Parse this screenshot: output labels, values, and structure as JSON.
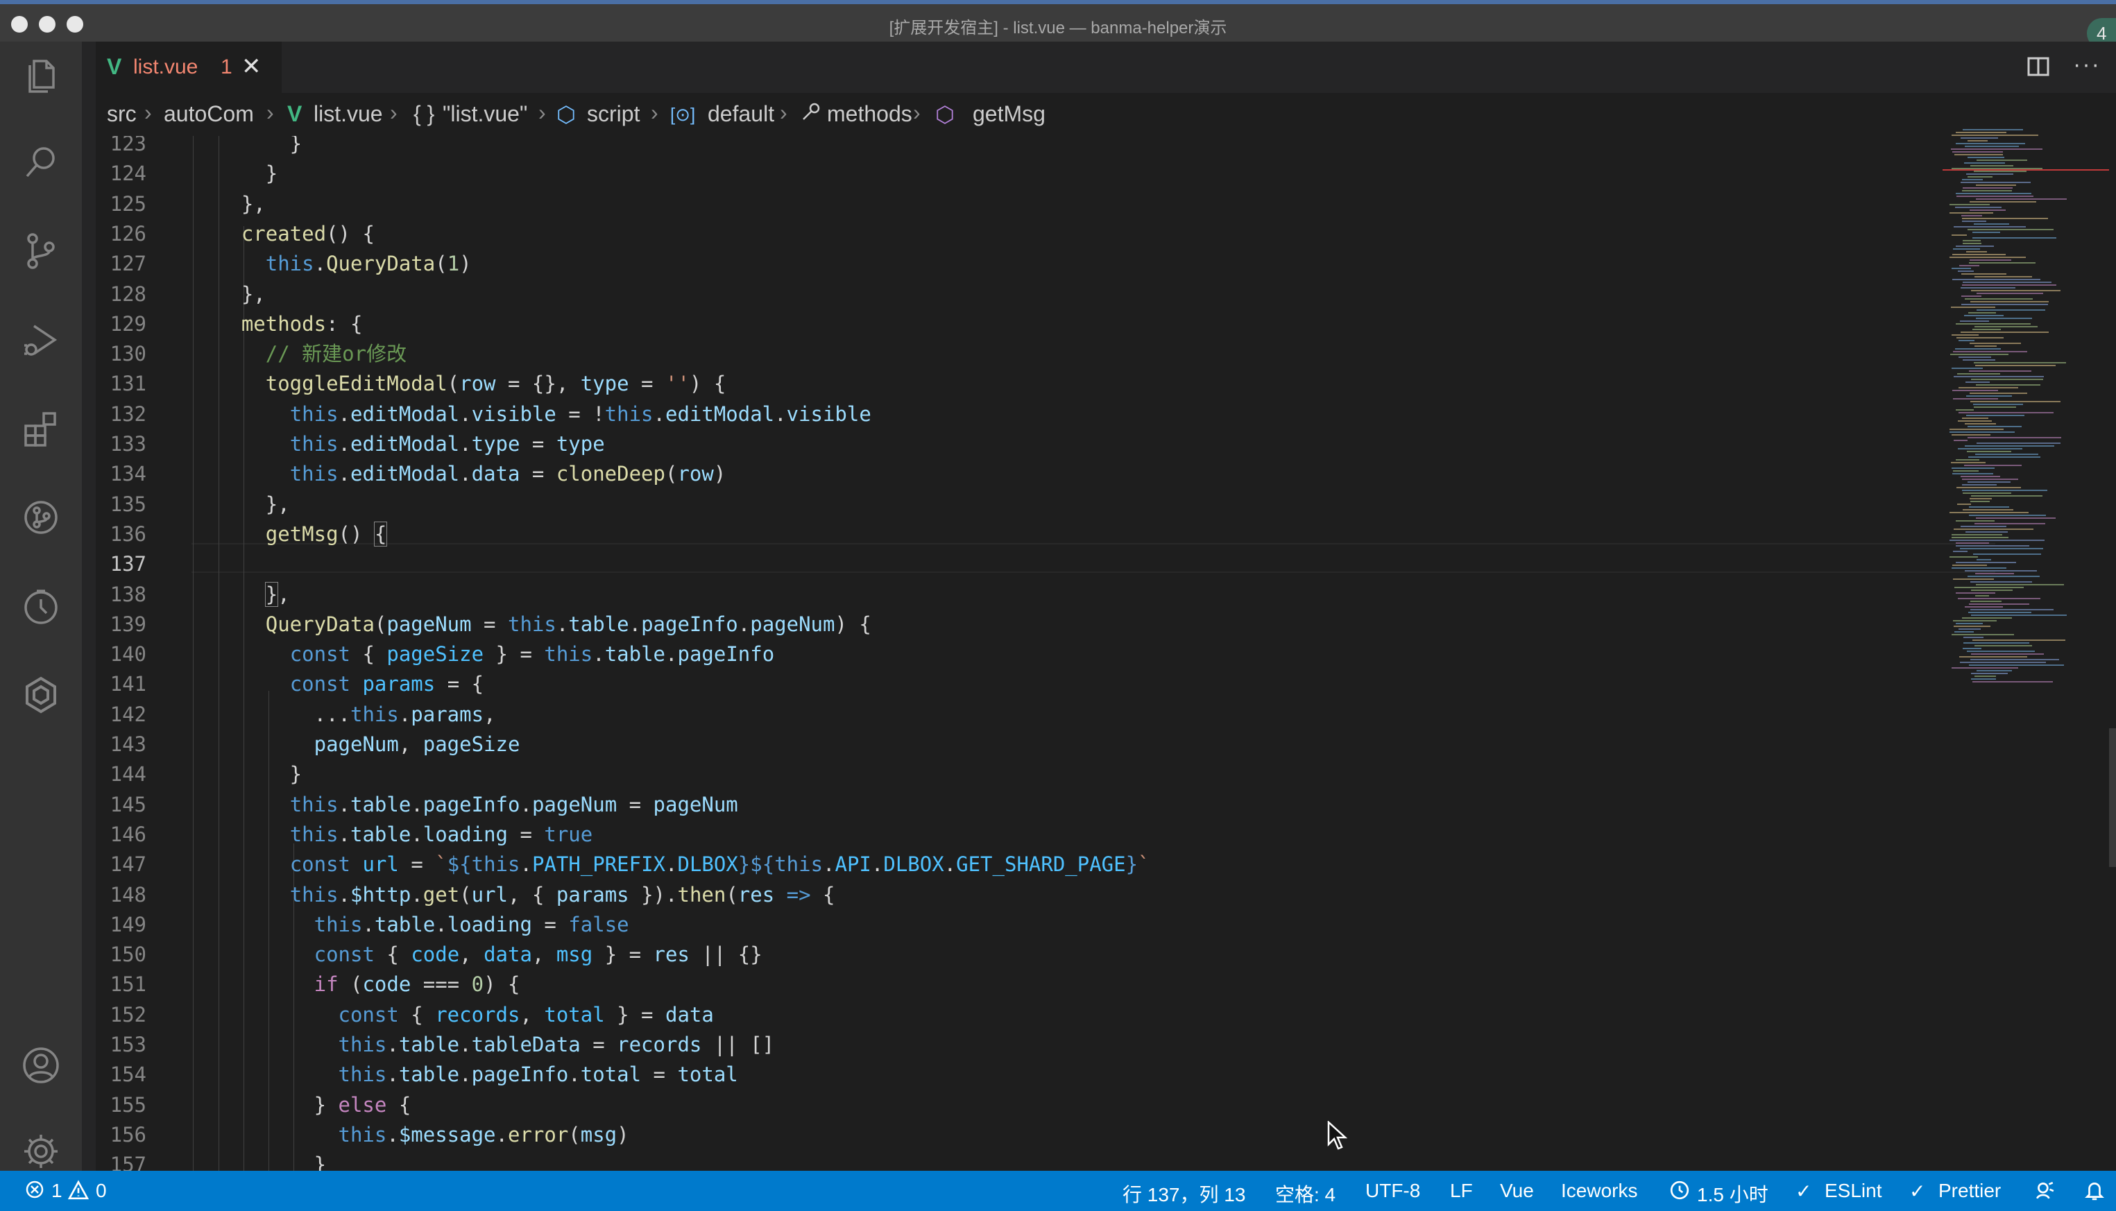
{
  "window": {
    "title": "[扩展开发宿主] - list.vue — banma-helper演示",
    "badge": "4"
  },
  "activity_bar": {
    "items": [
      "files-icon",
      "search-icon",
      "source-control-icon",
      "run-debug-icon",
      "extensions-icon",
      "git-graph-icon",
      "timeline-icon",
      "iceworks-icon"
    ],
    "bottom": [
      "account-icon",
      "settings-gear-icon"
    ]
  },
  "tab": {
    "name": "list.vue",
    "problems": "1",
    "close": "✕"
  },
  "breadcrumb": {
    "items": [
      "src",
      "autoCom",
      "list.vue",
      "\"list.vue\"",
      "script",
      "default",
      "methods",
      "getMsg"
    ],
    "obj_icon": "{ }",
    "default_icon": "[⊙]"
  },
  "editor": {
    "active_line": 137,
    "lines": [
      {
        "n": "123",
        "t": [
          "        }"
        ]
      },
      {
        "n": "124",
        "t": [
          "      }"
        ]
      },
      {
        "n": "125",
        "t": [
          "    },"
        ]
      },
      {
        "n": "126",
        "t": [
          "    ",
          "f:created",
          "() {"
        ]
      },
      {
        "n": "127",
        "t": [
          "      ",
          "k:this",
          ".",
          "f:QueryData",
          "(",
          "n:1",
          ")"
        ]
      },
      {
        "n": "128",
        "t": [
          "    },"
        ]
      },
      {
        "n": "129",
        "t": [
          "    ",
          "f:methods",
          ": {"
        ]
      },
      {
        "n": "130",
        "t": [
          "      ",
          "cm:// 新建or修改"
        ]
      },
      {
        "n": "131",
        "t": [
          "      ",
          "f:toggleEditModal",
          "(",
          "v:row",
          " = {}, ",
          "v:type",
          " = ",
          "s:''",
          ") {"
        ]
      },
      {
        "n": "132",
        "t": [
          "        ",
          "k:this",
          ".",
          "v:editModal",
          ".",
          "v:visible",
          " = !",
          "k:this",
          ".",
          "v:editModal",
          ".",
          "v:visible"
        ]
      },
      {
        "n": "133",
        "t": [
          "        ",
          "k:this",
          ".",
          "v:editModal",
          ".",
          "v:type",
          " = ",
          "v:type"
        ]
      },
      {
        "n": "134",
        "t": [
          "        ",
          "k:this",
          ".",
          "v:editModal",
          ".",
          "v:data",
          " = ",
          "f:cloneDeep",
          "(",
          "v:row",
          ")"
        ]
      },
      {
        "n": "135",
        "t": [
          "      },"
        ]
      },
      {
        "n": "136",
        "t": [
          "      ",
          "f:getMsg",
          "() ",
          "bm:{"
        ]
      },
      {
        "n": "137",
        "t": [
          ""
        ]
      },
      {
        "n": "138",
        "t": [
          "      ",
          "bm:}",
          ","
        ]
      },
      {
        "n": "139",
        "t": [
          "      ",
          "f:QueryData",
          "(",
          "v:pageNum",
          " = ",
          "k:this",
          ".",
          "v:table",
          ".",
          "v:pageInfo",
          ".",
          "v:pageNum",
          ") {"
        ]
      },
      {
        "n": "140",
        "t": [
          "        ",
          "k:const",
          " { ",
          "c:pageSize",
          " } = ",
          "k:this",
          ".",
          "v:table",
          ".",
          "v:pageInfo"
        ]
      },
      {
        "n": "141",
        "t": [
          "        ",
          "k:const",
          " ",
          "c:params",
          " = {"
        ]
      },
      {
        "n": "142",
        "t": [
          "          ...",
          "k:this",
          ".",
          "v:params",
          ","
        ]
      },
      {
        "n": "143",
        "t": [
          "          ",
          "v:pageNum",
          ", ",
          "v:pageSize"
        ]
      },
      {
        "n": "144",
        "t": [
          "        }"
        ]
      },
      {
        "n": "145",
        "t": [
          "        ",
          "k:this",
          ".",
          "v:table",
          ".",
          "v:pageInfo",
          ".",
          "v:pageNum",
          " = ",
          "v:pageNum"
        ]
      },
      {
        "n": "146",
        "t": [
          "        ",
          "k:this",
          ".",
          "v:table",
          ".",
          "v:loading",
          " = ",
          "k:true"
        ]
      },
      {
        "n": "147",
        "t": [
          "        ",
          "k:const",
          " ",
          "c:url",
          " = ",
          "s:`",
          "k:${",
          "k:this",
          ".",
          "c:PATH_PREFIX",
          ".",
          "c:DLBOX",
          "k:}${",
          "k:this",
          ".",
          "c:API",
          ".",
          "c:DLBOX",
          ".",
          "c:GET_SHARD_PAGE",
          "k:}",
          "s:`"
        ]
      },
      {
        "n": "148",
        "t": [
          "        ",
          "k:this",
          ".",
          "v:$http",
          ".",
          "f:get",
          "(",
          "v:url",
          ", { ",
          "v:params",
          " }).",
          "f:then",
          "(",
          "v:res",
          " ",
          "k:=>",
          " {"
        ]
      },
      {
        "n": "149",
        "t": [
          "          ",
          "k:this",
          ".",
          "v:table",
          ".",
          "v:loading",
          " = ",
          "k:false"
        ]
      },
      {
        "n": "150",
        "t": [
          "          ",
          "k:const",
          " { ",
          "c:code",
          ", ",
          "c:data",
          ", ",
          "c:msg",
          " } = ",
          "v:res",
          " || {}"
        ]
      },
      {
        "n": "151",
        "t": [
          "          ",
          "kc:if",
          " (",
          "v:code",
          " === ",
          "n:0",
          ") {"
        ]
      },
      {
        "n": "152",
        "t": [
          "            ",
          "k:const",
          " { ",
          "c:records",
          ", ",
          "c:total",
          " } = ",
          "v:data"
        ]
      },
      {
        "n": "153",
        "t": [
          "            ",
          "k:this",
          ".",
          "v:table",
          ".",
          "v:tableData",
          " = ",
          "v:records",
          " || []"
        ]
      },
      {
        "n": "154",
        "t": [
          "            ",
          "k:this",
          ".",
          "v:table",
          ".",
          "v:pageInfo",
          ".",
          "v:total",
          " = ",
          "v:total"
        ]
      },
      {
        "n": "155",
        "t": [
          "          } ",
          "kc:else",
          " {"
        ]
      },
      {
        "n": "156",
        "t": [
          "            ",
          "k:this",
          ".",
          "v:$message",
          ".",
          "f:error",
          "(",
          "v:msg",
          ")"
        ]
      },
      {
        "n": "157",
        "t": [
          "          }"
        ]
      }
    ]
  },
  "colors": {
    "status_bar": "#007acc",
    "activity_bar": "#333333",
    "editor_bg": "#1e1e1e",
    "vue_green": "#42b883",
    "error_red": "#f48771"
  },
  "status_bar": {
    "errors": "1",
    "warnings": "0",
    "position": "行 137，列 13",
    "indent": "空格: 4",
    "encoding": "UTF-8",
    "eol": "LF",
    "language": "Vue",
    "iceworks": "Iceworks",
    "time": "1.5 小时",
    "eslint": "ESLint",
    "prettier": "Prettier"
  }
}
